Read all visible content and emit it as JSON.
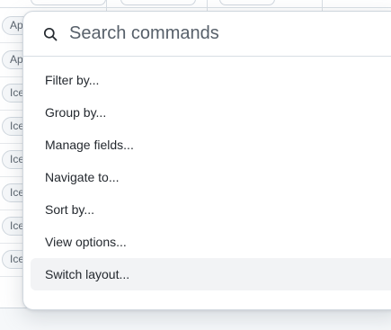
{
  "background": {
    "row_tags": [
      "Ap",
      "Ap",
      "Ice",
      "Ice",
      "Ice",
      "Ice",
      "Ice",
      "Ice"
    ]
  },
  "palette": {
    "search": {
      "placeholder": "Search commands",
      "value": "",
      "icon": "search-icon"
    },
    "commands": [
      {
        "label": "Filter by...",
        "active": false
      },
      {
        "label": "Group by...",
        "active": false
      },
      {
        "label": "Manage fields...",
        "active": false
      },
      {
        "label": "Navigate to...",
        "active": false
      },
      {
        "label": "Sort by...",
        "active": false
      },
      {
        "label": "View options...",
        "active": false
      },
      {
        "label": "Switch layout...",
        "active": true
      }
    ]
  },
  "colors": {
    "text": "#24292f",
    "muted": "#57606a",
    "border": "#d0d7de",
    "active_bg": "#f2f3f5"
  }
}
